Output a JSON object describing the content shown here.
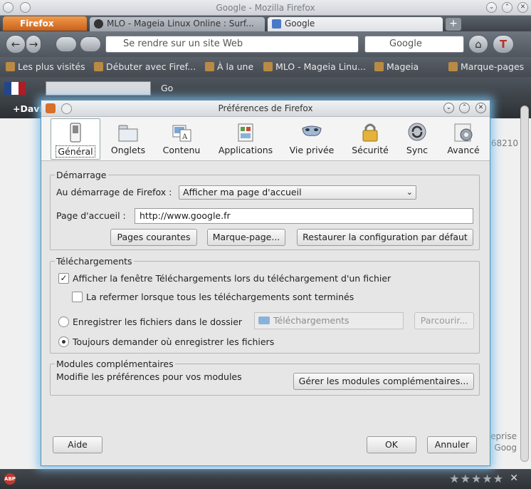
{
  "browser": {
    "window_title": "Google - Mozilla Firefox",
    "menu_button": "Firefox",
    "tabs": [
      {
        "label": "MLO - Mageia Linux Online : Surf..."
      },
      {
        "label": "Google"
      }
    ],
    "newtab_symbol": "+",
    "urlbar_placeholder": "Se rendre sur un site Web",
    "search_engine": "Google",
    "bookmarks": [
      {
        "label": "Les plus visités"
      },
      {
        "label": "Débuter avec Firef..."
      },
      {
        "label": "À la une"
      },
      {
        "label": "MLO - Mageia Linu..."
      },
      {
        "label": "Mageia"
      },
      {
        "label": "Marque-pages"
      }
    ],
    "addon_bar": {
      "go_label": "Go"
    },
    "page": {
      "user_text": "+Davi",
      "right_number": "68210",
      "right_text_1": "eprise",
      "right_text_2": "Goog"
    },
    "statusbar": {
      "abp": "ABP",
      "stars": "★★★★★",
      "close": "✕"
    }
  },
  "dialog": {
    "title": "Préférences de Firefox",
    "controls": {
      "minimize": "⌄",
      "maximize": "⌃",
      "close": "✕"
    },
    "panes": [
      {
        "label": "Général",
        "icon": "switch-icon"
      },
      {
        "label": "Onglets",
        "icon": "tabs-icon"
      },
      {
        "label": "Contenu",
        "icon": "content-icon"
      },
      {
        "label": "Applications",
        "icon": "applications-icon"
      },
      {
        "label": "Vie privée",
        "icon": "mask-icon"
      },
      {
        "label": "Sécurité",
        "icon": "lock-icon"
      },
      {
        "label": "Sync",
        "icon": "sync-icon"
      },
      {
        "label": "Avancé",
        "icon": "gear-icon"
      }
    ],
    "startup": {
      "legend": "Démarrage",
      "startup_label": "Au démarrage de Firefox :",
      "startup_value": "Afficher ma page d'accueil",
      "homepage_label": "Page d'accueil :",
      "homepage_value": "http://www.google.fr",
      "btn_current": "Pages courantes",
      "btn_bookmark": "Marque-page...",
      "btn_restore": "Restaurer la configuration par défaut"
    },
    "downloads": {
      "legend": "Téléchargements",
      "show_window_label": "Afficher la fenêtre Téléchargements lors du téléchargement d'un fichier",
      "close_when_done_label": "La refermer lorsque tous les téléchargements sont terminés",
      "save_to_label": "Enregistrer les fichiers dans le dossier",
      "folder_value": "Téléchargements",
      "browse_button": "Parcourir...",
      "always_ask_label": "Toujours demander où enregistrer les fichiers"
    },
    "addons": {
      "legend": "Modules complémentaires",
      "description": "Modifie les préférences pour vos modules",
      "manage_button": "Gérer les modules complémentaires..."
    },
    "footer": {
      "help_button": "Aide",
      "ok_button": "OK",
      "cancel_button": "Annuler"
    }
  }
}
